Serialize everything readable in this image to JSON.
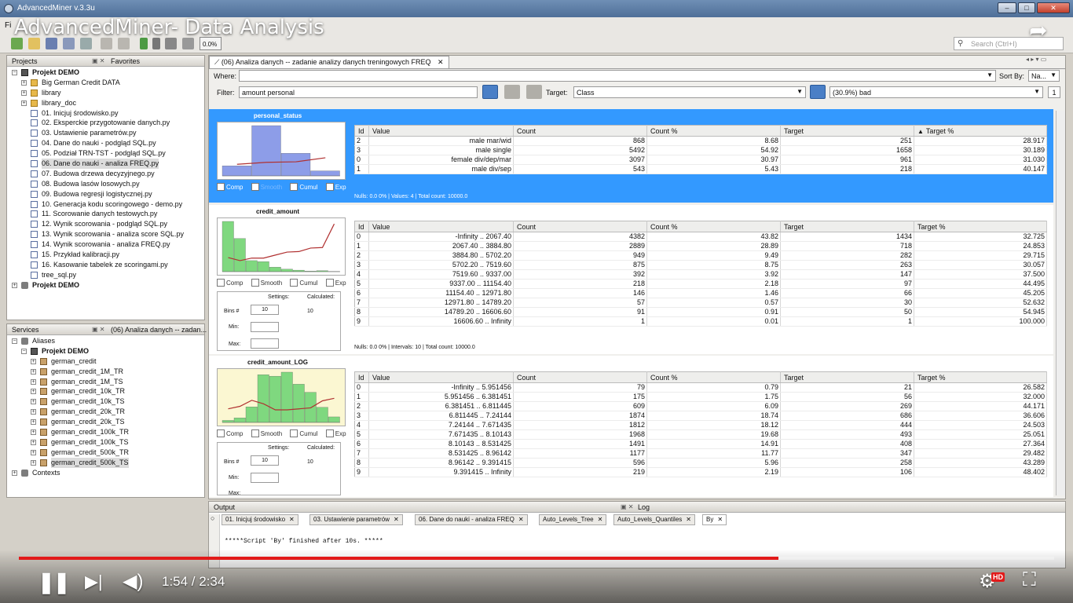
{
  "window": {
    "title": "AdvancedMiner v.3.3u",
    "menu_first": "Fi",
    "zoom": "0.0%",
    "search_placeholder": "Search (Ctrl+I)"
  },
  "video": {
    "title": "AdvancedMiner- Data Analysis",
    "time": "1:54 / 2:34",
    "progress": 0.734,
    "hd": "HD"
  },
  "projects": {
    "tab_projects": "Projects",
    "tab_favorites": "Favorites",
    "root": "Projekt DEMO",
    "items": [
      {
        "label": "Big German Credit DATA",
        "type": "folder",
        "expandable": true
      },
      {
        "label": "library",
        "type": "folder",
        "expandable": true
      },
      {
        "label": "library_doc",
        "type": "folder",
        "expandable": true
      },
      {
        "label": "01. Inicjuj środowisko.py",
        "type": "doc"
      },
      {
        "label": "02. Eksperckie przygotowanie danych.py",
        "type": "doc"
      },
      {
        "label": "03. Ustawienie parametrów.py",
        "type": "doc"
      },
      {
        "label": "04. Dane do nauki - podgląd SQL.py",
        "type": "doc"
      },
      {
        "label": "05. Podział TRN-TST - podgląd SQL.py",
        "type": "doc"
      },
      {
        "label": "06. Dane do nauki - analiza FREQ.py",
        "type": "doc",
        "selected": true
      },
      {
        "label": "07. Budowa drzewa decyzyjnego.py",
        "type": "doc"
      },
      {
        "label": "08. Budowa lasów losowych.py",
        "type": "doc"
      },
      {
        "label": "09. Budowa regresji logistycznej.py",
        "type": "doc"
      },
      {
        "label": "10. Generacja kodu scoringowego - demo.py",
        "type": "doc"
      },
      {
        "label": "11. Scorowanie danych testowych.py",
        "type": "doc"
      },
      {
        "label": "12. Wynik scorowania - podgląd SQL.py",
        "type": "doc"
      },
      {
        "label": "13. Wynik scorowania - analiza score SQL.py",
        "type": "doc"
      },
      {
        "label": "14. Wynik scorowania - analiza FREQ.py",
        "type": "doc"
      },
      {
        "label": "15. Przykład kalibracji.py",
        "type": "doc"
      },
      {
        "label": "16. Kasowanie tabelek ze scoringami.py",
        "type": "doc"
      },
      {
        "label": "tree_sql.py",
        "type": "doc"
      }
    ],
    "second_root": "Projekt DEMO"
  },
  "services": {
    "tab_services": "Services",
    "tab_doc": "(06) Analiza danych -- zadan...",
    "aliases": "Aliases",
    "project": "Projekt DEMO",
    "tables": [
      "german_credit",
      "german_credit_1M_TR",
      "german_credit_1M_TS",
      "german_credit_10k_TR",
      "german_credit_10k_TS",
      "german_credit_20k_TR",
      "german_credit_20k_TS",
      "german_credit_100k_TR",
      "german_credit_100k_TS",
      "german_credit_500k_TR",
      "german_credit_500k_TS"
    ],
    "contexts": "Contexts"
  },
  "editor": {
    "tab": "(06) Analiza danych -- zadanie analizy danych treningowych FREQ",
    "where_label": "Where:",
    "where_value": "",
    "sortby_label": "Sort By:",
    "sortby_value": "Na...",
    "filter_label": "Filter:",
    "filter_value": "amount personal",
    "target_label": "Target:",
    "target_value": "Class",
    "target_class": "(30.9%) bad",
    "page_num": "1"
  },
  "columns": {
    "id": "Id",
    "value": "Value",
    "count": "Count",
    "countpct": "Count %",
    "target": "Target",
    "targetpct": "Target %"
  },
  "checks": {
    "comp": "Comp",
    "smooth": "Smooth",
    "cumul": "Cumul",
    "exp": "Exp"
  },
  "settings_labels": {
    "settings": "Settings:",
    "calculated": "Calculated:",
    "bins": "Bins #",
    "min": "Min:",
    "max": "Max:"
  },
  "sections": [
    {
      "name": "personal_status",
      "selected": true,
      "sort_indicator": "▲",
      "status": "Nulls: 0.0 0% | Values: 4 | Total count: 10000.0",
      "histogram": [
        0.2,
        1.0,
        0.45,
        0.1
      ],
      "trend": [
        0.23,
        0.27,
        0.28,
        0.36
      ],
      "rows": [
        [
          "2",
          "male mar/wid",
          "868",
          "8.68",
          "251",
          "28.917"
        ],
        [
          "3",
          "male single",
          "5492",
          "54.92",
          "1658",
          "30.189"
        ],
        [
          "0",
          "female div/dep/mar",
          "3097",
          "30.97",
          "961",
          "31.030"
        ],
        [
          "1",
          "male div/sep",
          "543",
          "5.43",
          "218",
          "40.147"
        ]
      ]
    },
    {
      "name": "credit_amount",
      "selected": false,
      "status": "Nulls: 0.0 0% | Intervals: 10 | Total count: 10000.0",
      "settings": {
        "bins": "10",
        "calculated": "10",
        "min": "",
        "max": ""
      },
      "histogram": [
        1.0,
        0.66,
        0.22,
        0.2,
        0.09,
        0.05,
        0.03,
        0.01,
        0.02,
        0.003
      ],
      "trend": [
        0.28,
        0.22,
        0.27,
        0.27,
        0.33,
        0.39,
        0.4,
        0.47,
        0.48,
        0.95
      ],
      "rows": [
        [
          "0",
          "-Infinity  ..  2067.40",
          "4382",
          "43.82",
          "1434",
          "32.725"
        ],
        [
          "1",
          "2067.40  ..  3884.80",
          "2889",
          "28.89",
          "718",
          "24.853"
        ],
        [
          "2",
          "3884.80  ..  5702.20",
          "949",
          "9.49",
          "282",
          "29.715"
        ],
        [
          "3",
          "5702.20  ..  7519.60",
          "875",
          "8.75",
          "263",
          "30.057"
        ],
        [
          "4",
          "7519.60  ..  9337.00",
          "392",
          "3.92",
          "147",
          "37.500"
        ],
        [
          "5",
          "9337.00  ..  11154.40",
          "218",
          "2.18",
          "97",
          "44.495"
        ],
        [
          "6",
          "11154.40  ..  12971.80",
          "146",
          "1.46",
          "66",
          "45.205"
        ],
        [
          "7",
          "12971.80  ..  14789.20",
          "57",
          "0.57",
          "30",
          "52.632"
        ],
        [
          "8",
          "14789.20  ..  16606.60",
          "91",
          "0.91",
          "50",
          "54.945"
        ],
        [
          "9",
          "16606.60  ..  Infinity",
          "1",
          "0.01",
          "1",
          "100.000"
        ]
      ]
    },
    {
      "name": "credit_amount_LOG",
      "selected": false,
      "status": "",
      "settings": {
        "bins": "10",
        "calculated": "10",
        "min": "",
        "max": ""
      },
      "histogram": [
        0.04,
        0.09,
        0.31,
        0.95,
        0.92,
        1.0,
        0.76,
        0.6,
        0.3,
        0.11
      ],
      "trend": [
        0.27,
        0.32,
        0.44,
        0.37,
        0.25,
        0.25,
        0.27,
        0.29,
        0.43,
        0.48
      ],
      "rows": [
        [
          "0",
          "-Infinity  ..  5.951456",
          "79",
          "0.79",
          "21",
          "26.582"
        ],
        [
          "1",
          "5.951456  ..  6.381451",
          "175",
          "1.75",
          "56",
          "32.000"
        ],
        [
          "2",
          "6.381451  ..  6.811445",
          "609",
          "6.09",
          "269",
          "44.171"
        ],
        [
          "3",
          "6.811445  ..  7.24144",
          "1874",
          "18.74",
          "686",
          "36.606"
        ],
        [
          "4",
          "7.24144  ..  7.671435",
          "1812",
          "18.12",
          "444",
          "24.503"
        ],
        [
          "5",
          "7.671435  ..  8.10143",
          "1968",
          "19.68",
          "493",
          "25.051"
        ],
        [
          "6",
          "8.10143  ..  8.531425",
          "1491",
          "14.91",
          "408",
          "27.364"
        ],
        [
          "7",
          "8.531425  ..  8.96142",
          "1177",
          "11.77",
          "347",
          "29.482"
        ],
        [
          "8",
          "8.96142  ..  9.391415",
          "596",
          "5.96",
          "258",
          "43.289"
        ],
        [
          "9",
          "9.391415  ..  Infinity",
          "219",
          "2.19",
          "106",
          "48.402"
        ]
      ]
    }
  ],
  "output": {
    "title": "Output",
    "log_tab": "Log",
    "tabs": [
      "01. Inicjuj środowisko",
      "03. Ustawienie parametrów",
      "06. Dane do nauki - analiza FREQ",
      "Auto_Levels_Tree",
      "Auto_Levels_Quantiles",
      "By"
    ],
    "text": "*****Script 'By' finished after 10s. *****"
  },
  "colors": {
    "selection": "#3399ff",
    "bars": "#7fd87f",
    "bars_selected": "#8d9de8",
    "trend": "#b03030",
    "progress": "#e21a1a"
  }
}
